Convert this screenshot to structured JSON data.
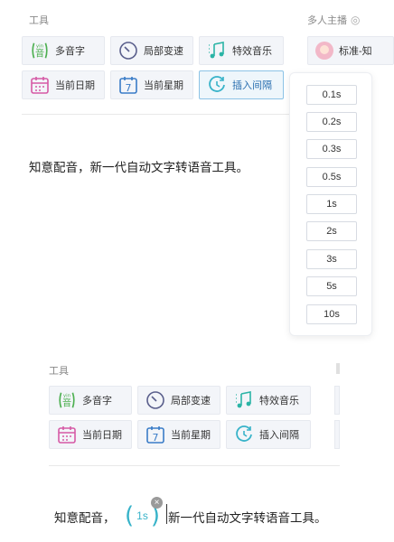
{
  "panel1": {
    "tools_label": "工具",
    "multi_speaker_label": "多人主播",
    "speaker_name": "标准-知",
    "buttons": [
      {
        "label": "多音字",
        "icon": "pinyin-icon"
      },
      {
        "label": "局部变速",
        "icon": "speed-dial-icon"
      },
      {
        "label": "特效音乐",
        "icon": "music-note-icon"
      },
      {
        "label": "当前日期",
        "icon": "calendar-icon"
      },
      {
        "label": "当前星期",
        "icon": "weekday-icon"
      },
      {
        "label": "插入间隔",
        "icon": "clock-pause-icon"
      }
    ],
    "pinyin_top": "yin",
    "pinyin_char": "音",
    "weekday_number": "7",
    "editor_text": "知意配音，新一代自动文字转语音工具。",
    "pause_options": [
      "0.1s",
      "0.2s",
      "0.3s",
      "0.5s",
      "1s",
      "2s",
      "3s",
      "5s",
      "10s"
    ]
  },
  "panel2": {
    "tools_label": "工具",
    "buttons": [
      {
        "label": "多音字"
      },
      {
        "label": "局部变速"
      },
      {
        "label": "特效音乐"
      },
      {
        "label": "当前日期"
      },
      {
        "label": "当前星期"
      },
      {
        "label": "插入间隔"
      }
    ],
    "text_before": "知意配音，",
    "pause_value": "1s",
    "text_after": "新一代自动文字转语音工具。"
  },
  "colors": {
    "accent_blue": "#2a6fb0",
    "teal": "#38b3c9",
    "pinyin_green": "#4caf50",
    "calendar_pink": "#d65aa6",
    "music_teal": "#2bb4a6"
  }
}
